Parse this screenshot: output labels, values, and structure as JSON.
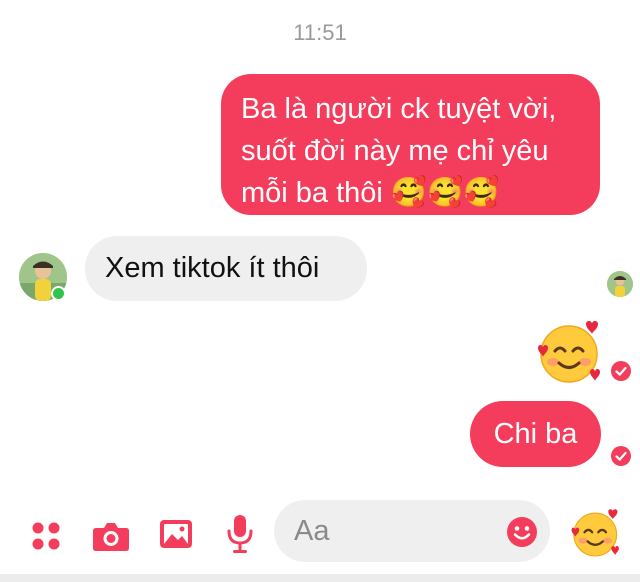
{
  "header": {
    "time": "11:51"
  },
  "messages": {
    "outgoing_1": {
      "lines": [
        "Ba là người ck tuyệt vời,",
        "suốt đời này mẹ chỉ yêu",
        "mỗi ba thôi 🥰🥰🥰"
      ]
    },
    "incoming_1": {
      "text": "Xem tiktok ít thôi"
    },
    "outgoing_2": {
      "emoji": "🥰"
    },
    "outgoing_3": {
      "text": "Chi ba"
    }
  },
  "composer": {
    "placeholder": "Aa",
    "icons": [
      "menu-icon",
      "camera-icon",
      "image-icon",
      "mic-icon",
      "smiley-icon"
    ],
    "send_emoji": "🥰"
  },
  "colors": {
    "outgoing_bubble": "#f43d5c",
    "incoming_bubble": "#efefef",
    "accent": "#f43d5c",
    "online": "#31c44a",
    "timestamp": "#9a9a9a"
  }
}
